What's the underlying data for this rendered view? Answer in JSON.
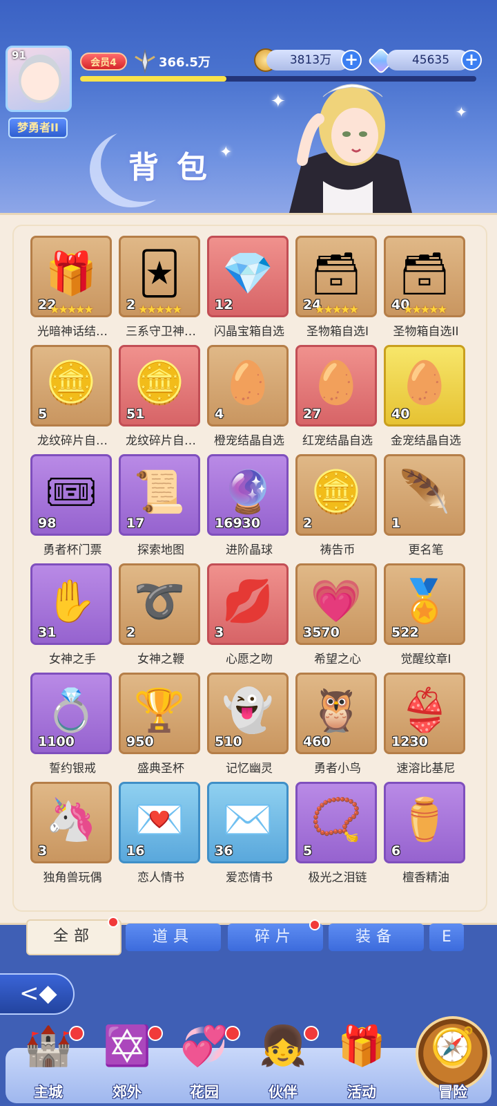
{
  "header": {
    "avatar_level": "91",
    "player_name": "梦勇者II",
    "vip_label": "会员4",
    "power": "366.5万",
    "exp_progress": 0.37,
    "gold": "3813万",
    "diamonds": "45635",
    "plus_label": "+",
    "title": "背包"
  },
  "items": [
    {
      "name": "光暗神话结…",
      "count": "22",
      "rarity": "orange",
      "stars": "★★★★★",
      "icon": "🎁"
    },
    {
      "name": "三系守卫神…",
      "count": "2",
      "rarity": "orange",
      "stars": "★★★★★",
      "icon": "🃏"
    },
    {
      "name": "闪晶宝箱自选",
      "count": "12",
      "rarity": "red",
      "stars": "",
      "icon": "💎"
    },
    {
      "name": "圣物箱自选I",
      "count": "24",
      "rarity": "orange",
      "stars": "★★★★★",
      "icon": "🗃"
    },
    {
      "name": "圣物箱自选II",
      "count": "40",
      "rarity": "orange",
      "stars": "★★★★★",
      "icon": "🗃"
    },
    {
      "name": "龙纹碎片自…",
      "count": "5",
      "rarity": "orange",
      "stars": "",
      "icon": "🪙"
    },
    {
      "name": "龙纹碎片自…",
      "count": "51",
      "rarity": "red",
      "stars": "",
      "icon": "🪙"
    },
    {
      "name": "橙宠结晶自选",
      "count": "4",
      "rarity": "orange",
      "stars": "",
      "icon": "🥚"
    },
    {
      "name": "红宠结晶自选",
      "count": "27",
      "rarity": "red",
      "stars": "",
      "icon": "🥚"
    },
    {
      "name": "金宠结晶自选",
      "count": "40",
      "rarity": "gold",
      "stars": "",
      "icon": "🥚"
    },
    {
      "name": "勇者杯门票",
      "count": "98",
      "rarity": "purple",
      "stars": "",
      "icon": "🎟"
    },
    {
      "name": "探索地图",
      "count": "17",
      "rarity": "purple",
      "stars": "",
      "icon": "📜"
    },
    {
      "name": "进阶晶球",
      "count": "16930",
      "rarity": "purple",
      "stars": "",
      "icon": "🔮"
    },
    {
      "name": "祷告币",
      "count": "2",
      "rarity": "orange",
      "stars": "",
      "icon": "🪙"
    },
    {
      "name": "更名笔",
      "count": "1",
      "rarity": "orange",
      "stars": "",
      "icon": "🪶"
    },
    {
      "name": "女神之手",
      "count": "31",
      "rarity": "purple",
      "stars": "",
      "icon": "✋"
    },
    {
      "name": "女神之鞭",
      "count": "2",
      "rarity": "orange",
      "stars": "",
      "icon": "➰"
    },
    {
      "name": "心愿之吻",
      "count": "3",
      "rarity": "red",
      "stars": "",
      "icon": "💋"
    },
    {
      "name": "希望之心",
      "count": "3570",
      "rarity": "orange",
      "stars": "",
      "icon": "💗"
    },
    {
      "name": "觉醒纹章I",
      "count": "522",
      "rarity": "orange",
      "stars": "",
      "icon": "🏅"
    },
    {
      "name": "誓约银戒",
      "count": "1100",
      "rarity": "purple",
      "stars": "",
      "icon": "💍"
    },
    {
      "name": "盛典圣杯",
      "count": "950",
      "rarity": "orange",
      "stars": "",
      "icon": "🏆"
    },
    {
      "name": "记忆幽灵",
      "count": "510",
      "rarity": "orange",
      "stars": "",
      "icon": "👻"
    },
    {
      "name": "勇者小鸟",
      "count": "460",
      "rarity": "orange",
      "stars": "",
      "icon": "🦉"
    },
    {
      "name": "速溶比基尼",
      "count": "1230",
      "rarity": "orange",
      "stars": "",
      "icon": "👙"
    },
    {
      "name": "独角兽玩偶",
      "count": "3",
      "rarity": "orange",
      "stars": "",
      "icon": "🦄"
    },
    {
      "name": "恋人情书",
      "count": "16",
      "rarity": "blue",
      "stars": "",
      "icon": "💌"
    },
    {
      "name": "爱恋情书",
      "count": "36",
      "rarity": "blue",
      "stars": "",
      "icon": "✉️"
    },
    {
      "name": "极光之泪链",
      "count": "5",
      "rarity": "purple",
      "stars": "",
      "icon": "📿"
    },
    {
      "name": "檀香精油",
      "count": "6",
      "rarity": "purple",
      "stars": "",
      "icon": "⚱️"
    }
  ],
  "tabs": [
    {
      "label": "全部",
      "active": true,
      "badge": true
    },
    {
      "label": "道具",
      "active": false,
      "badge": false
    },
    {
      "label": "碎片",
      "active": false,
      "badge": true
    },
    {
      "label": "装备",
      "active": false,
      "badge": false
    },
    {
      "label": "E",
      "active": false,
      "badge": false
    }
  ],
  "nav": [
    {
      "label": "主城",
      "icon": "🏰",
      "badge": true
    },
    {
      "label": "郊外",
      "icon": "✡️",
      "badge": true
    },
    {
      "label": "花园",
      "icon": "💞",
      "badge": true
    },
    {
      "label": "伙伴",
      "icon": "👧",
      "badge": true
    },
    {
      "label": "活动",
      "icon": "🎁",
      "badge": false
    },
    {
      "label": "冒险",
      "icon": "🧭",
      "badge": false
    }
  ],
  "back_icon": "<◆"
}
